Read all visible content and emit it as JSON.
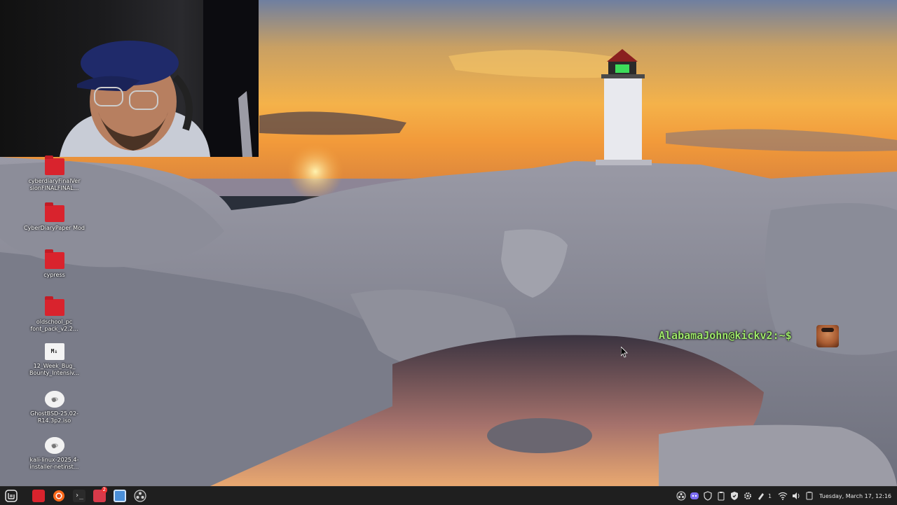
{
  "desktop": {
    "icons": [
      {
        "label": "cyberdiaryFinalVer sionFINALFINAL...",
        "icon": "folder-icon"
      },
      {
        "label": "CyberDiaryPaper Mod",
        "icon": "folder-icon"
      },
      {
        "label": "cypress",
        "icon": "folder-icon"
      },
      {
        "label": "oldschool_pc font_pack_v2.2...",
        "icon": "folder-icon"
      },
      {
        "label": "12_Week_Bug_ Bounty_Intensiv...",
        "icon": "markdown-file-icon",
        "glyph_text": "M↓"
      },
      {
        "label": "GhostBSD-25.02- R14.3p2.iso",
        "icon": "disc-image-icon"
      },
      {
        "label": "kali-linux-2025.4- installer-netinst...",
        "icon": "disc-image-icon"
      }
    ],
    "prompt_text": "AlabamaJohn@kickv2:~$"
  },
  "taskbar": {
    "menu_icon": "mint-menu-icon",
    "apps": [
      {
        "name": "files",
        "icon": "folder-icon",
        "color": "#d9232d"
      },
      {
        "name": "firefox",
        "icon": "firefox-icon",
        "color": "#ff6a1a"
      },
      {
        "name": "terminal",
        "icon": "terminal-icon",
        "color": "#2b2b2b"
      },
      {
        "name": "image-viewer",
        "icon": "image-viewer-icon",
        "color": "#d83a4a",
        "badge": "2"
      },
      {
        "name": "browser",
        "icon": "browser-window-icon",
        "color": "#4a8fd8"
      },
      {
        "name": "obs",
        "icon": "obs-icon",
        "color": "#cfcfcf"
      }
    ],
    "tray": {
      "workspace_count": "1",
      "clock": "Tuesday, March 17, 12:16"
    }
  }
}
